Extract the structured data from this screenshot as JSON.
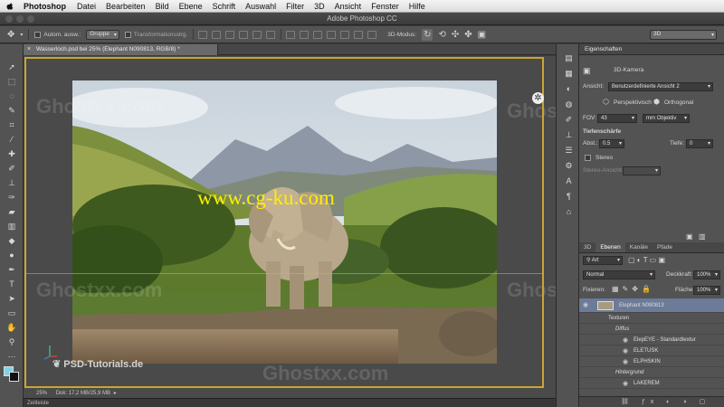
{
  "menubar": {
    "app": "Photoshop",
    "items": [
      "Datei",
      "Bearbeiten",
      "Bild",
      "Ebene",
      "Schrift",
      "Auswahl",
      "Filter",
      "3D",
      "Ansicht",
      "Fenster",
      "Hilfe"
    ]
  },
  "titlebar": {
    "title": "Adobe Photoshop CC"
  },
  "options": {
    "auto_select_label": "Autom. ausw.:",
    "group_value": "Gruppe",
    "transform_label": "Transformationsstrg.",
    "mode_label": "3D-Modus:",
    "workspace_value": "3D"
  },
  "document": {
    "tab_title": "Wasserloch.psd bei 25% (Elephant N090813, RGB/8) *",
    "zoom": "25%",
    "doc_info": "Dok: 17,2 MB/25,9 MB",
    "timeline_label": "Zeitleiste"
  },
  "watermarks": {
    "site": "www.cg-ku.com",
    "ghost": "Ghostxx.com",
    "psd": "PSD-Tutorials.de"
  },
  "properties": {
    "title": "Eigenschaften",
    "camera_label": "3D-Kamera",
    "view_label": "Ansicht:",
    "view_value": "Benutzerdefinierte Ansicht 2",
    "perspective_label": "Perspektivisch",
    "ortho_label": "Orthogonal",
    "fov_label": "FOV:",
    "fov_value": "43",
    "lens_value": "mm Objektiv",
    "dof_label": "Tiefenschärfe",
    "dist_label": "Abst.:",
    "dist_value": "0.5",
    "depth_label": "Tiefe:",
    "depth_value": "0",
    "stereo_label": "Stereo",
    "stereo_view_label": "Stereo-Ansicht:"
  },
  "layers": {
    "tabs": [
      "3D",
      "Ebenen",
      "Kanäle",
      "Pfade"
    ],
    "active_tab": "Ebenen",
    "filter_value": "Art",
    "blend_mode": "Normal",
    "opacity_label": "Deckkraft:",
    "opacity_value": "100%",
    "lock_label": "Fixieren:",
    "fill_label": "Fläche:",
    "fill_value": "100%",
    "rows": [
      {
        "name": "Elephant N090813",
        "selected": true
      },
      {
        "name": "Texturen"
      },
      {
        "name": "Diffus"
      },
      {
        "name": "ElepEYE - Standardtextur"
      },
      {
        "name": "ELETUSK"
      },
      {
        "name": "ELPHSKIN"
      },
      {
        "name": "Hintergrund"
      },
      {
        "name": "LAKEREM"
      }
    ]
  },
  "colors": {
    "accent_gold": "#c9a534",
    "foreground": "#7fd3e6",
    "background": "#111111",
    "watermark_yellow": "#ffee00"
  }
}
